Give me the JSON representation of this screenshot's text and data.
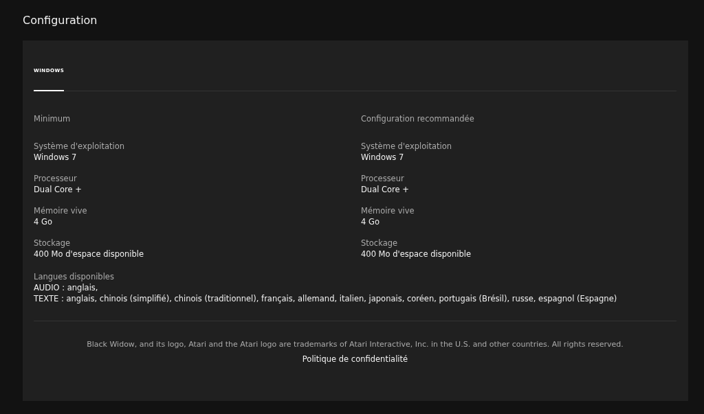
{
  "title": "Configuration",
  "tabs": [
    {
      "label": "WINDOWS",
      "selected": true
    }
  ],
  "columns": [
    {
      "heading": "Minimum",
      "specs": [
        {
          "label": "Système d'exploitation",
          "value": "Windows 7"
        },
        {
          "label": "Processeur",
          "value": "Dual Core +"
        },
        {
          "label": "Mémoire vive",
          "value": "4 Go"
        },
        {
          "label": "Stockage",
          "value": "400 Mo d'espace disponible"
        }
      ]
    },
    {
      "heading": "Configuration recommandée",
      "specs": [
        {
          "label": "Système d'exploitation",
          "value": "Windows 7"
        },
        {
          "label": "Processeur",
          "value": "Dual Core +"
        },
        {
          "label": "Mémoire vive",
          "value": "4 Go"
        },
        {
          "label": "Stockage",
          "value": "400 Mo d'espace disponible"
        }
      ]
    }
  ],
  "languages": {
    "label": "Langues disponibles",
    "lines": [
      "AUDIO : anglais,",
      "TEXTE : anglais, chinois (simplifié), chinois (traditionnel), français, allemand, italien, japonais, coréen, portugais (Brésil), russe, espagnol (Espagne)"
    ]
  },
  "footer": {
    "legal": "Black Widow, and its logo, Atari and the Atari logo are trademarks of Atari Interactive, Inc. in the U.S. and other countries. All rights reserved.",
    "link": "Politique de confidentialité"
  }
}
